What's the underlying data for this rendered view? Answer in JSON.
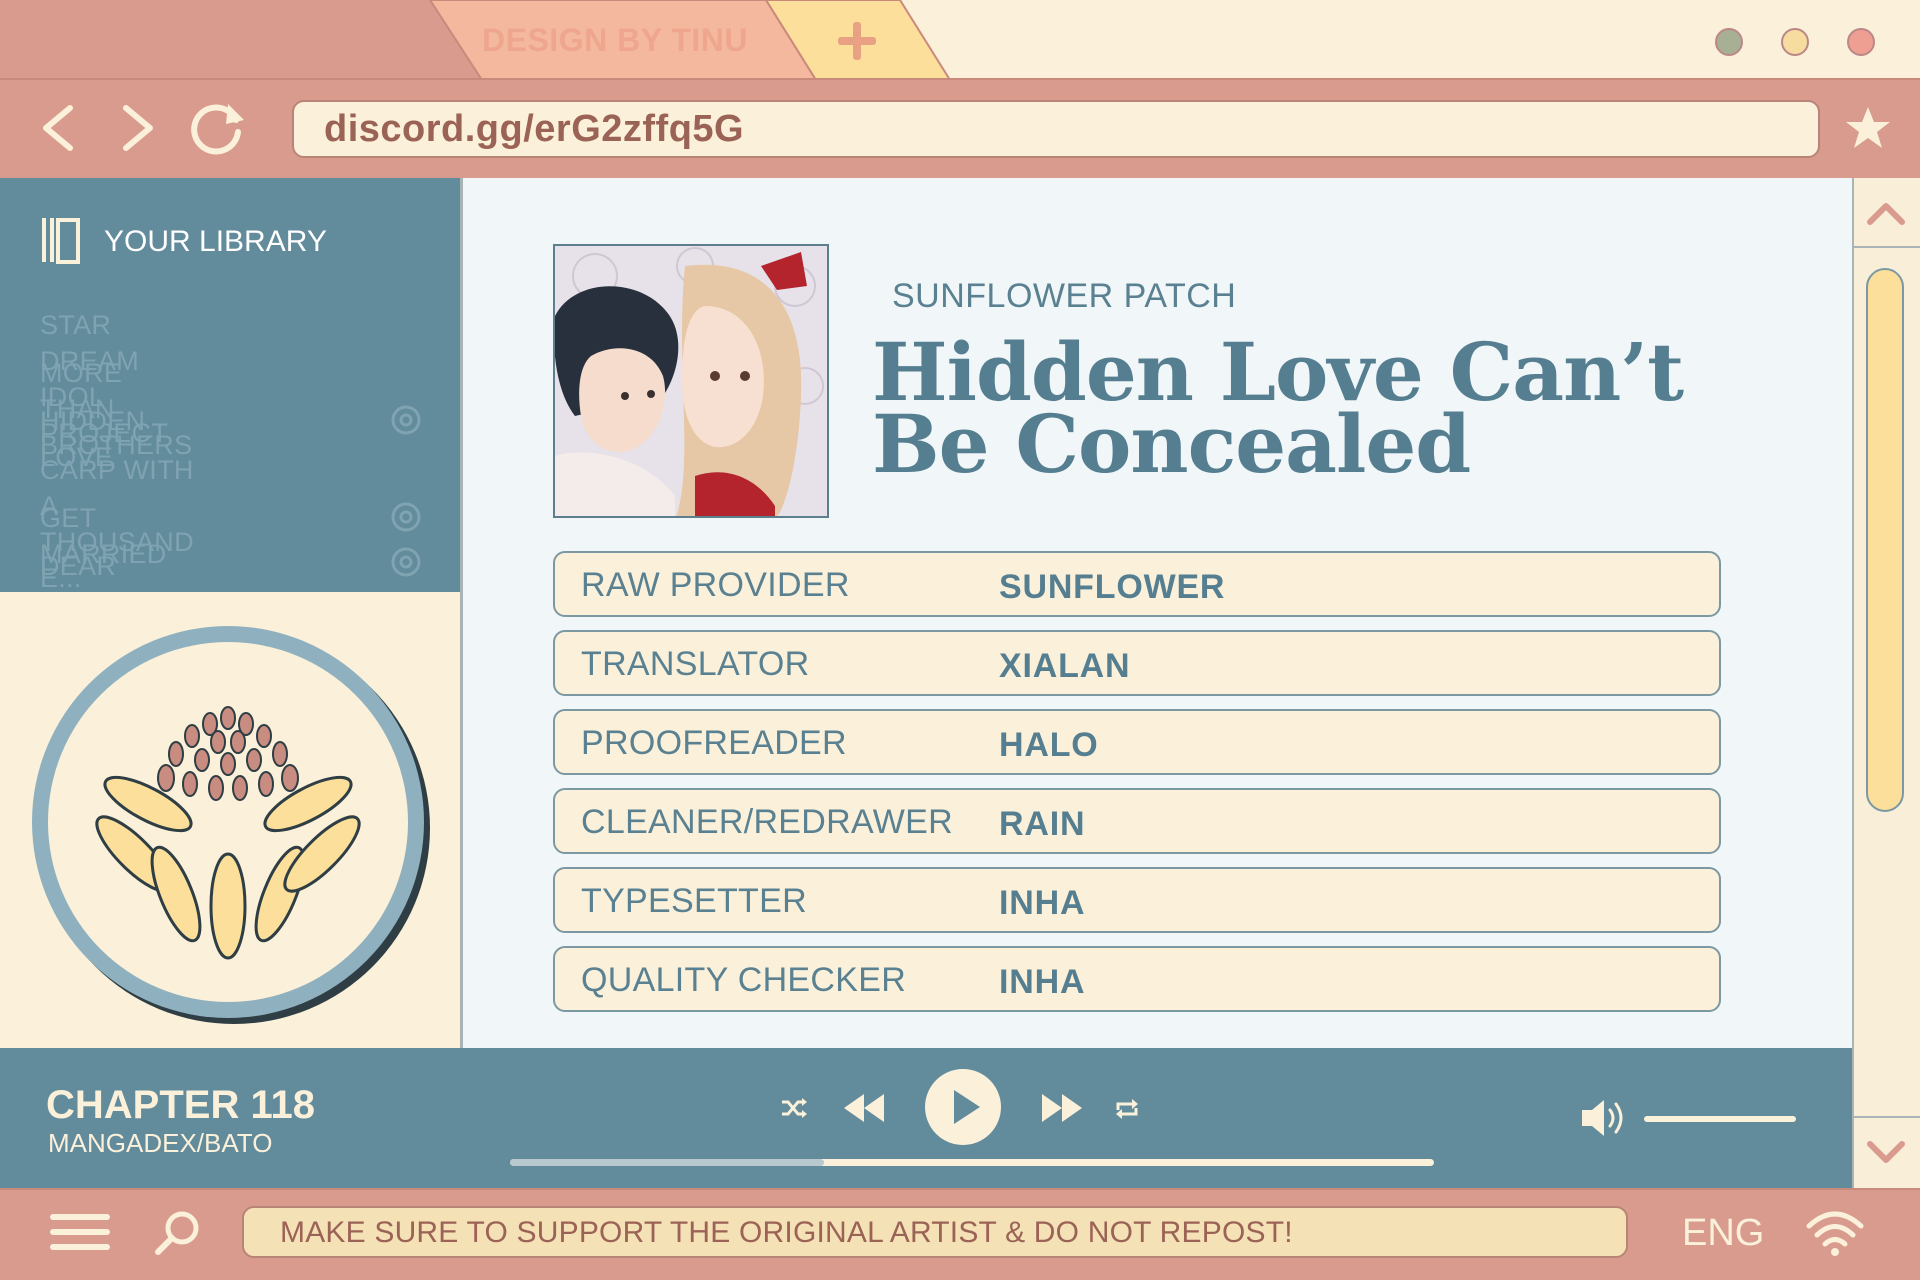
{
  "browser": {
    "tab_label": "DESIGN BY TINU",
    "url": "discord.gg/erG2zffq5G",
    "icons": [
      "back-arrow-icon",
      "forward-arrow-icon",
      "refresh-icon",
      "star-icon",
      "plus-icon"
    ]
  },
  "sidebar": {
    "title": "YOUR LIBRARY",
    "items": [
      {
        "label": "STAR DREAM IDOL PROJECT",
        "icon": ""
      },
      {
        "label": "MORE THAN BROTHERS",
        "icon": ""
      },
      {
        "label": "HIDDEN LOVE",
        "icon": "flower-badge-icon"
      },
      {
        "label": "CARP WITH A THOUSAND E...",
        "icon": ""
      },
      {
        "label": "GET MARRIED",
        "icon": "flower-badge-icon"
      },
      {
        "label": "DEAR DREAMERS",
        "icon": "flower-badge-icon"
      }
    ]
  },
  "main": {
    "group": "SUNFLOWER PATCH",
    "title_line1": "Hidden Love Can’t",
    "title_line2": "Be Concealed",
    "credits": [
      {
        "role": "RAW PROVIDER",
        "name": "SUNFLOWER"
      },
      {
        "role": "TRANSLATOR",
        "name": "XIALAN"
      },
      {
        "role": "PROOFREADER",
        "name": "HALO"
      },
      {
        "role": "CLEANER/REDRAWER",
        "name": "RAIN"
      },
      {
        "role": "TYPESETTER",
        "name": "INHA"
      },
      {
        "role": "QUALITY CHECKER",
        "name": "INHA"
      }
    ]
  },
  "player": {
    "chapter": "CHAPTER 118",
    "source": "MANGADEX/BATO",
    "progress": 0.34,
    "volume": 1.0
  },
  "bottom": {
    "notice": "MAKE SURE TO SUPPORT THE ORIGINAL ARTIST & DO NOT REPOST!",
    "language": "ENG"
  },
  "colors": {
    "salmon": "#d89b8d",
    "cream": "#fbf0da",
    "teal": "#628b9c",
    "yellow": "#fbdf9a"
  }
}
